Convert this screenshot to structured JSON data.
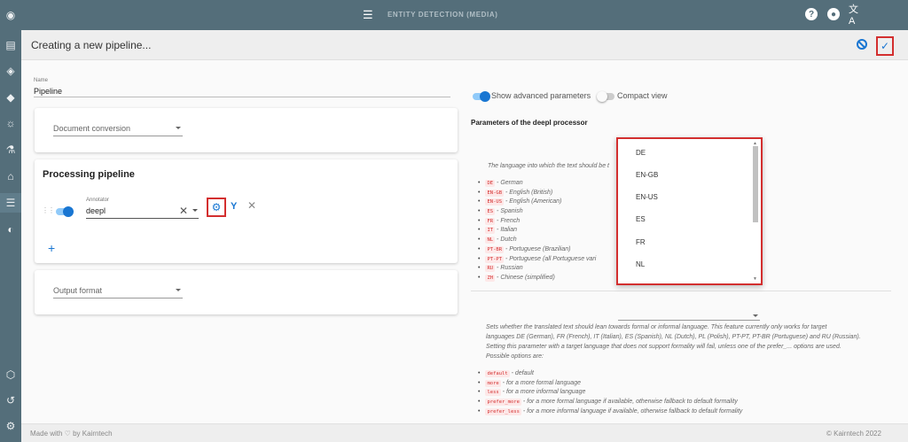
{
  "topbar": {
    "menu_icon": "menu-icon",
    "title": "ENTITY DETECTION (MEDIA)",
    "help_icon": "help-icon",
    "account_icon": "account-icon",
    "language_icon": "translate-icon"
  },
  "sidebar": {
    "icons": [
      "logo-icon",
      "document-icon",
      "compass-icon",
      "tag-icon",
      "bulb-icon",
      "flask-icon",
      "bank-icon",
      "list-icon",
      "eye-icon",
      "cube-icon",
      "history-icon",
      "settings-icon"
    ]
  },
  "subbar": {
    "title": "Creating a new pipeline...",
    "cancel_icon": "cancel-icon",
    "save_icon": "check-icon"
  },
  "form": {
    "name_label": "Name",
    "name_value": "Pipeline",
    "document_conversion_placeholder": "Document conversion",
    "processing_title": "Processing pipeline",
    "annotator_label": "Annotator",
    "annotator_value": "deepl",
    "clear_glyph": "✕",
    "remove_glyph": "✕",
    "add_glyph": "+",
    "output_format_placeholder": "Output format"
  },
  "right": {
    "show_advanced_label": "Show advanced parameters",
    "compact_view_label": "Compact view",
    "params_title": "Parameters of the deepl processor",
    "target_lang_desc": "The language into which the text should be t",
    "languages": [
      {
        "code": "DE",
        "name": "German"
      },
      {
        "code": "EN-GB",
        "name": "English (British)"
      },
      {
        "code": "EN-US",
        "name": "English (American)"
      },
      {
        "code": "ES",
        "name": "Spanish"
      },
      {
        "code": "FR",
        "name": "French"
      },
      {
        "code": "IT",
        "name": "Italian"
      },
      {
        "code": "NL",
        "name": "Dutch"
      },
      {
        "code": "PT-BR",
        "name": "Portuguese (Brazilian)"
      },
      {
        "code": "PT-PT",
        "name": "Portuguese (all Portuguese vari"
      },
      {
        "code": "RU",
        "name": "Russian"
      },
      {
        "code": "ZH",
        "name": "Chinese (simplified)"
      }
    ],
    "formality_desc_1": "Sets whether the translated text should lean towards formal or informal language. This feature currently only works for target",
    "formality_desc_2": "languages DE (German), FR (French), IT (Italian), ES (Spanish), NL (Dutch), PL (Polish), PT-PT, PT-BR (Portuguese) and RU (Russian).",
    "formality_desc_3": "Setting this parameter with a target language that does not support formality will fail, unless one of the prefer_... options are used.",
    "formality_desc_4": "Possible options are:",
    "formality_options": [
      {
        "code": "default",
        "desc": "default"
      },
      {
        "code": "more",
        "desc": "for a more formal language"
      },
      {
        "code": "less",
        "desc": "for a more informal language"
      },
      {
        "code": "prefer_more",
        "desc": "for a more formal language if available, otherwise fallback to default formality"
      },
      {
        "code": "prefer_less",
        "desc": "for a more informal language if available, otherwise fallback to default formality"
      }
    ]
  },
  "dropdown": {
    "options": [
      "DE",
      "EN-GB",
      "EN-US",
      "ES",
      "FR",
      "NL"
    ]
  },
  "footer": {
    "left": "Made with ♡ by Kairntech",
    "right": "©   Kairntech 2022"
  },
  "colors": {
    "primary": "#1976d2",
    "topbar": "#546e7a",
    "highlight": "#d32f2f"
  }
}
